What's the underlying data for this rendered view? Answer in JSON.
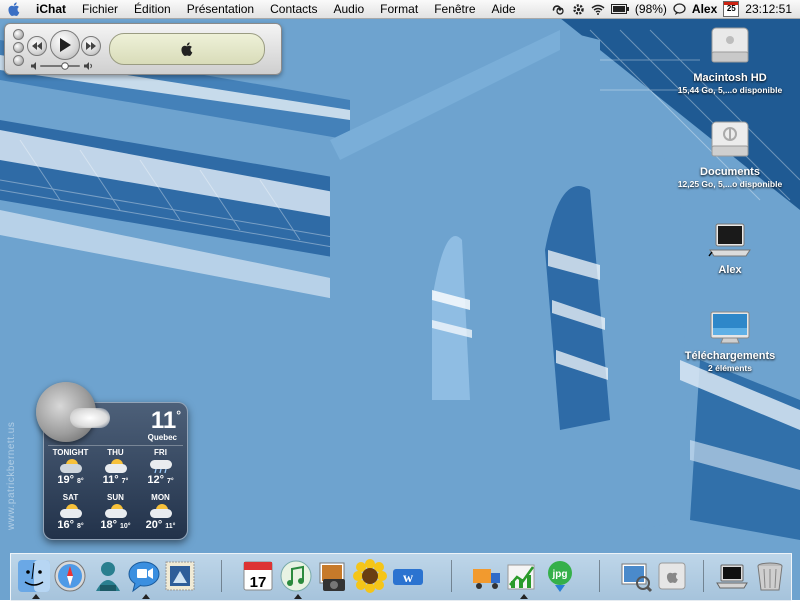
{
  "menubar": {
    "app_name": "iChat",
    "menus": [
      "Fichier",
      "Édition",
      "Présentation",
      "Contacts",
      "Audio",
      "Format",
      "Fenêtre",
      "Aide"
    ],
    "battery": "(98%)",
    "user": "Alex",
    "calendar_day": "25",
    "clock": "23:12:51"
  },
  "itunes": {
    "lcd_icon": "apple-logo-icon"
  },
  "desktop_icons": [
    {
      "name": "Macintosh HD",
      "sub": "15,44 Go, 5,...o disponible",
      "icon": "hard-drive-icon"
    },
    {
      "name": "Documents",
      "sub": "12,25 Go, 5,...o disponible",
      "icon": "drive-icon"
    },
    {
      "name": "Alex",
      "sub": "",
      "icon": "laptop-icon"
    },
    {
      "name": "Téléchargements",
      "sub": "2 éléments",
      "icon": "folder-icon"
    }
  ],
  "weather": {
    "temperature": "11",
    "degree": "°",
    "city": "Quebec",
    "forecast": [
      {
        "day": "TONIGHT",
        "high": "19°",
        "low": "8°"
      },
      {
        "day": "THU",
        "high": "11°",
        "low": "7°"
      },
      {
        "day": "FRI",
        "high": "12°",
        "low": "7°"
      },
      {
        "day": "SAT",
        "high": "16°",
        "low": "8°"
      },
      {
        "day": "SUN",
        "high": "18°",
        "low": "10°"
      },
      {
        "day": "MON",
        "high": "20°",
        "low": "11°"
      }
    ]
  },
  "watermark": "www.patrickbernett.us",
  "dock": {
    "items": [
      "finder",
      "safari",
      "ichat-buddy",
      "ichat",
      "stamp",
      "ical",
      "itunes",
      "iphoto",
      "sunflower",
      "word",
      "delivery",
      "chart",
      "jpg-converter",
      "preview",
      "system",
      "macbook",
      "trash"
    ],
    "calendar_date": "17",
    "jpg_label": "jpg"
  },
  "colors": {
    "wallpaper": "#6ea3cf",
    "menubar": "#eeeeee"
  }
}
